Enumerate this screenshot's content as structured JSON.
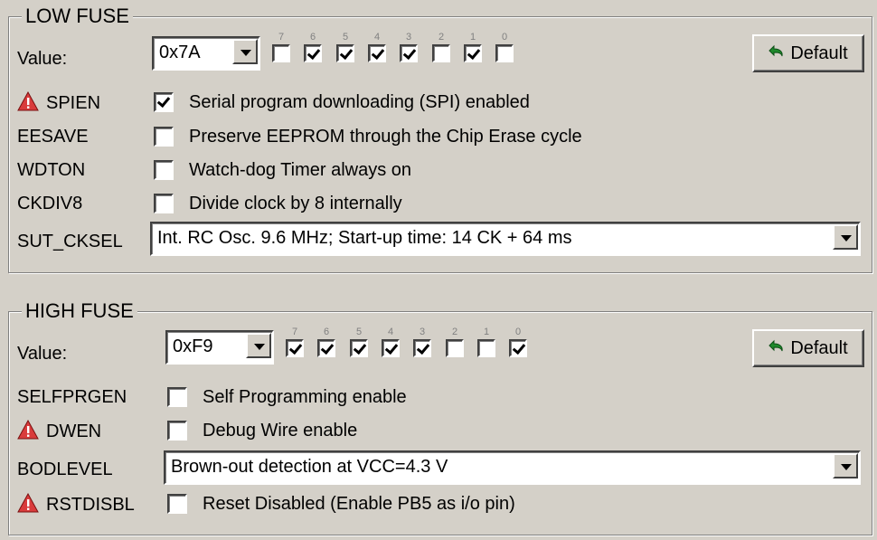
{
  "low": {
    "title": "LOW FUSE",
    "value_label": "Value:",
    "value": "0x7A",
    "default_label": "Default",
    "bits": [
      {
        "num": "7",
        "checked": false
      },
      {
        "num": "6",
        "checked": true
      },
      {
        "num": "5",
        "checked": true
      },
      {
        "num": "4",
        "checked": true
      },
      {
        "num": "3",
        "checked": true
      },
      {
        "num": "2",
        "checked": false
      },
      {
        "num": "1",
        "checked": true
      },
      {
        "num": "0",
        "checked": false
      }
    ],
    "options": [
      {
        "name": "SPIEN",
        "warn": true,
        "checked": true,
        "text": "Serial program downloading (SPI) enabled"
      },
      {
        "name": "EESAVE",
        "warn": false,
        "checked": false,
        "text": "Preserve EEPROM through the Chip Erase cycle"
      },
      {
        "name": "WDTON",
        "warn": false,
        "checked": false,
        "text": "Watch-dog Timer always on"
      },
      {
        "name": "CKDIV8",
        "warn": false,
        "checked": false,
        "text": "Divide clock by 8 internally"
      }
    ],
    "select": {
      "name": "SUT_CKSEL",
      "value": "Int. RC Osc. 9.6 MHz; Start-up time: 14 CK + 64 ms"
    }
  },
  "high": {
    "title": "HIGH FUSE",
    "value_label": "Value:",
    "value": "0xF9",
    "default_label": "Default",
    "bits": [
      {
        "num": "7",
        "checked": true
      },
      {
        "num": "6",
        "checked": true
      },
      {
        "num": "5",
        "checked": true
      },
      {
        "num": "4",
        "checked": true
      },
      {
        "num": "3",
        "checked": true
      },
      {
        "num": "2",
        "checked": false
      },
      {
        "num": "1",
        "checked": false
      },
      {
        "num": "0",
        "checked": true
      }
    ],
    "options": [
      {
        "name": "SELFPRGEN",
        "warn": false,
        "checked": false,
        "text": "Self Programming enable"
      },
      {
        "name": "DWEN",
        "warn": true,
        "checked": false,
        "text": "Debug Wire enable"
      }
    ],
    "select": {
      "name": "BODLEVEL",
      "value": "Brown-out detection at VCC=4.3 V"
    },
    "last_option": {
      "name": "RSTDISBL",
      "warn": true,
      "checked": false,
      "text": "Reset Disabled (Enable PB5 as i/o pin)"
    }
  },
  "colors": {
    "background": "#d4d0c8",
    "warning": "#d93b3b"
  },
  "icons": {
    "warning": "warning-triangle-icon",
    "default": "undo-arrow-icon",
    "dropdown": "chevron-down-icon"
  }
}
